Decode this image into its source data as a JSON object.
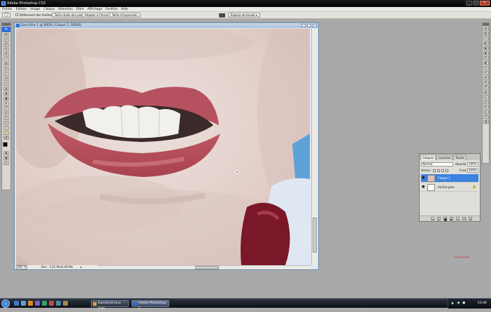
{
  "window": {
    "title": "Adobe Photoshop CS3",
    "controls": {
      "minimize": "_",
      "maximize": "□",
      "close": "✕"
    }
  },
  "menu": [
    "Fichier",
    "Edition",
    "Image",
    "Calque",
    "Sélection",
    "Filtre",
    "Affichage",
    "Fenêtre",
    "Aide"
  ],
  "options": {
    "scroll_all_label": "Défilement des fenêtres",
    "actual_pixels": "Taille réelle des pixels",
    "fit_screen": "Adapter à l'écran",
    "print_size": "Taille d'impression",
    "workspace": "Espace de travail ▾"
  },
  "document": {
    "title": "Sans titre-1 @ 800% (Calque 1, RVB/8)",
    "zoom": "800 %",
    "info": "Doc : 3,22 Mo/3,49 Mo",
    "info_arrow": "▸"
  },
  "layers_panel": {
    "tabs": [
      "Calques",
      "Couches",
      "Tracés"
    ],
    "blend_mode": "Normal",
    "opacity_label": "Opacité :",
    "opacity_value": "100%",
    "lock_label": "Verrou :",
    "fill_label": "Fond :",
    "fill_value": "100%",
    "layers": [
      {
        "name": "Calque 1",
        "selected": true
      },
      {
        "name": "Arrière-plan",
        "selected": false
      }
    ]
  },
  "taskbar": {
    "tasks": [
      {
        "label": "Gamekult Jeux Vidé...",
        "active": false
      },
      {
        "label": "Adobe Photoshop C...",
        "active": true
      }
    ],
    "clock": "23:46"
  },
  "watermark": "Gamekult",
  "colors": {
    "accent": "#3c82e0",
    "lips": "#b8525e",
    "skin": "#e6d4cf"
  }
}
